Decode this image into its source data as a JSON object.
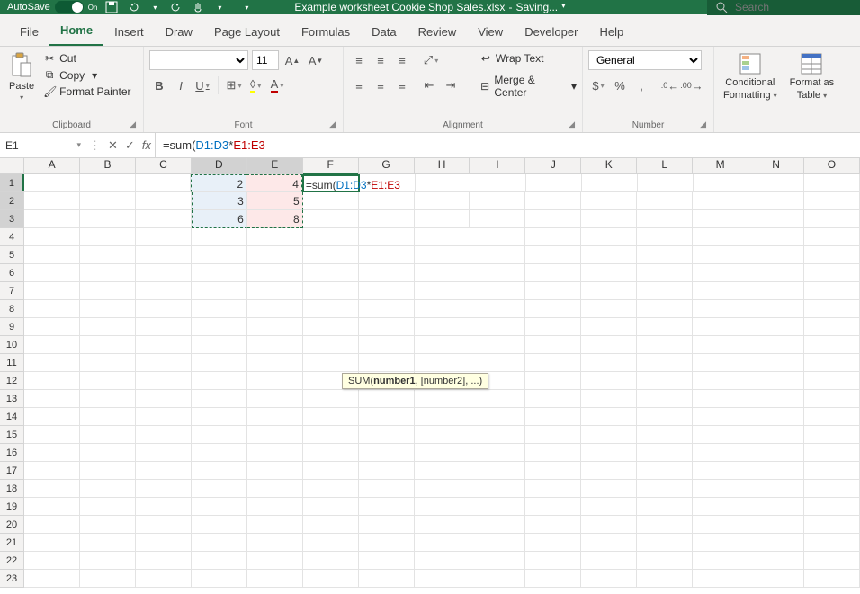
{
  "title": {
    "autosave_label": "AutoSave",
    "autosave_state": "On",
    "filename": "Example worksheet Cookie Shop Sales.xlsx",
    "dash": "-",
    "status": "Saving...",
    "search_placeholder": "Search"
  },
  "tabs": {
    "file": "File",
    "home": "Home",
    "insert": "Insert",
    "draw": "Draw",
    "page_layout": "Page Layout",
    "formulas": "Formulas",
    "data": "Data",
    "review": "Review",
    "view": "View",
    "developer": "Developer",
    "help": "Help"
  },
  "ribbon": {
    "clipboard": {
      "paste": "Paste",
      "cut": "Cut",
      "copy": "Copy",
      "format_painter": "Format Painter",
      "label": "Clipboard"
    },
    "font": {
      "size": "11",
      "label": "Font"
    },
    "alignment": {
      "wrap": "Wrap Text",
      "merge": "Merge & Center",
      "label": "Alignment"
    },
    "number": {
      "format": "General",
      "label": "Number"
    },
    "styles": {
      "cond": "Conditional",
      "cond2": "Formatting",
      "fmt_as": "Format as",
      "fmt_as2": "Table"
    }
  },
  "fx": {
    "name_box": "E1",
    "formula_pre": "=sum(",
    "ref1": "D1:D3",
    "op": "*",
    "ref2": "E1:E3"
  },
  "tooltip": {
    "fn": "SUM",
    "open": "(",
    "arg1": "number1",
    "rest": ", [number2], ...)"
  },
  "columns": [
    "A",
    "B",
    "C",
    "D",
    "E",
    "F",
    "G",
    "H",
    "I",
    "J",
    "K",
    "L",
    "M",
    "N",
    "O"
  ],
  "row_count": 23,
  "cells": {
    "D1": "2",
    "D2": "3",
    "D3": "6",
    "E1": "4",
    "E2": "5",
    "E3": "8"
  },
  "chart_data": null
}
